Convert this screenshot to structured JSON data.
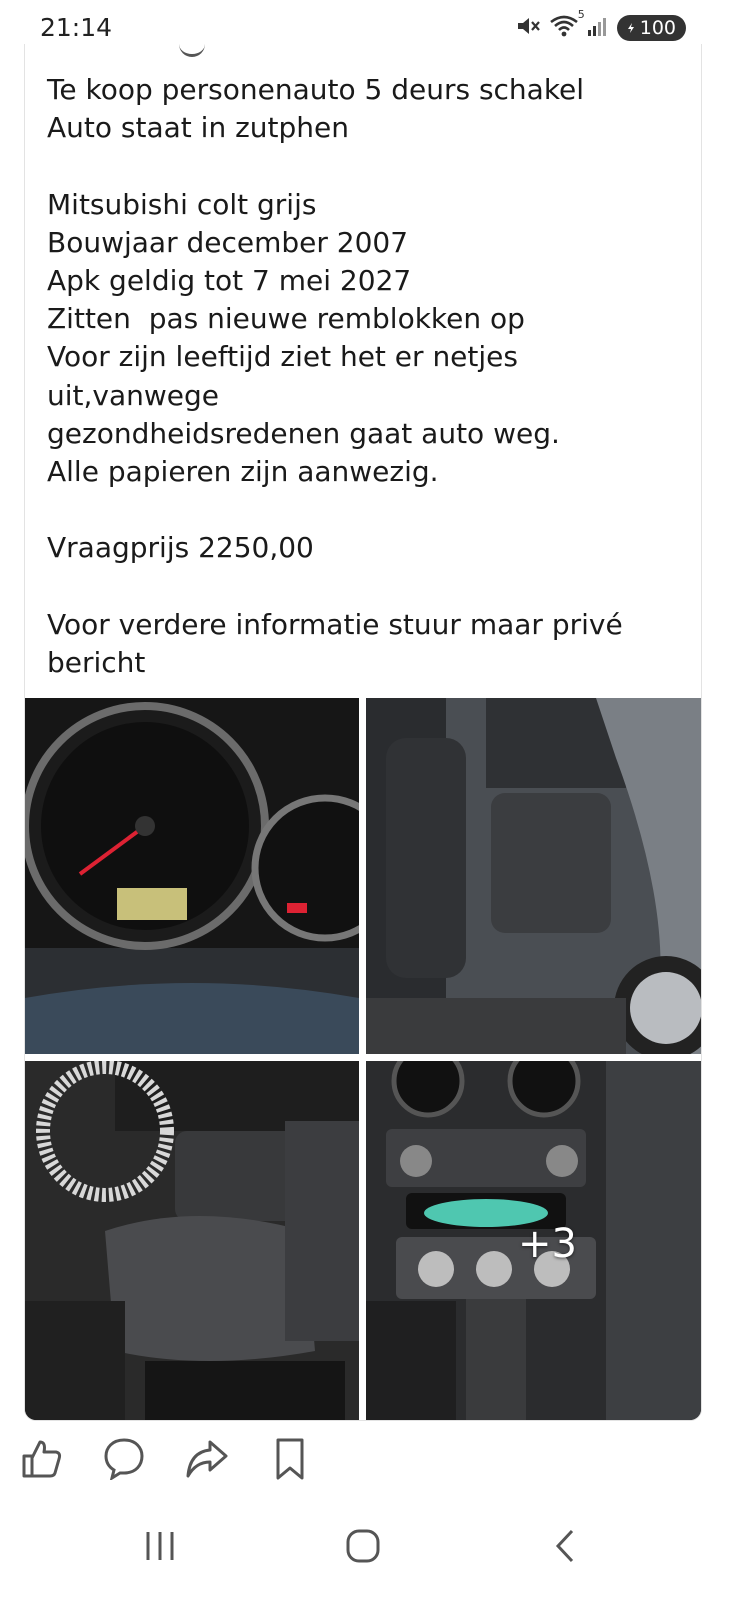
{
  "status_bar": {
    "time": "21:14",
    "wifi_badge": "5",
    "battery": "100",
    "icons": [
      "mute-icon",
      "wifi-icon",
      "signal-icon",
      "battery-icon"
    ]
  },
  "post": {
    "lines": [
      "Te koop personenauto 5 deurs schakel",
      "Auto staat in zutphen",
      "",
      "Mitsubishi colt grijs",
      "Bouwjaar december 2007",
      "Apk geldig tot 7 mei 2027",
      "Zitten  pas nieuwe remblokken op",
      "Voor zijn leeftijd ziet het er netjes",
      "uit,vanwege",
      "gezondheidsredenen gaat auto weg.",
      "Alle papieren zijn aanwezig.",
      "",
      "Vraagprijs 2250,00",
      "",
      "Voor verdere informatie stuur maar privé",
      "bericht"
    ],
    "photos": {
      "more_count": "+3"
    }
  },
  "actions": [
    "like-icon",
    "comment-icon",
    "share-icon",
    "save-icon"
  ],
  "nav": [
    "recent-apps-icon",
    "home-icon",
    "back-icon"
  ],
  "colors": {
    "text": "#1a1a1a",
    "icon": "#555555",
    "border": "#e3e3e3"
  }
}
